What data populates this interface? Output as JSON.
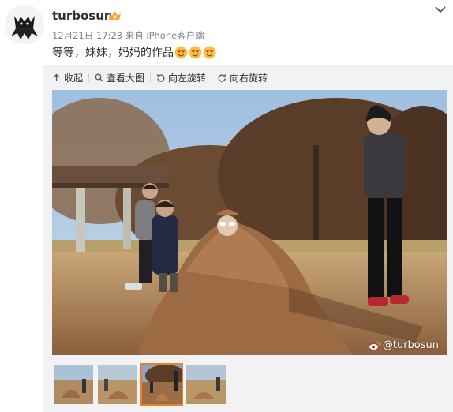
{
  "post": {
    "username": "turbosun",
    "date": "12月21日 17:23",
    "source_prefix": "来自",
    "source": "iPhone客户端",
    "text": "等等，妹妹，妈妈的作品",
    "emoji_icons": [
      "heart-eyes-emoji-icon",
      "heart-eyes-emoji-icon",
      "heart-eyes-emoji-icon"
    ]
  },
  "toolbar": {
    "collapse_label": "收起",
    "view_large_label": "查看大图",
    "rotate_left_label": "向左旋转",
    "rotate_right_label": "向右旋转"
  },
  "photo": {
    "watermark": "@turbosun"
  },
  "thumbnails": {
    "count": 4,
    "selected_index": 2
  },
  "colors": {
    "accent": "#e8812d",
    "text": "#333333",
    "meta": "#808080",
    "emoji": "#f7c242"
  }
}
